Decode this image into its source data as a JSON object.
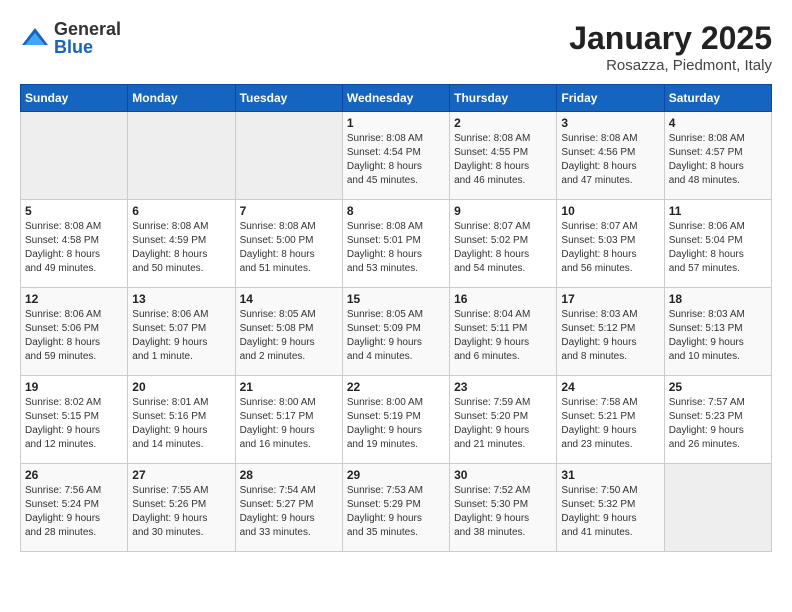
{
  "header": {
    "logo_general": "General",
    "logo_blue": "Blue",
    "month": "January 2025",
    "location": "Rosazza, Piedmont, Italy"
  },
  "days_of_week": [
    "Sunday",
    "Monday",
    "Tuesday",
    "Wednesday",
    "Thursday",
    "Friday",
    "Saturday"
  ],
  "weeks": [
    [
      {
        "day": "",
        "info": ""
      },
      {
        "day": "",
        "info": ""
      },
      {
        "day": "",
        "info": ""
      },
      {
        "day": "1",
        "info": "Sunrise: 8:08 AM\nSunset: 4:54 PM\nDaylight: 8 hours\nand 45 minutes."
      },
      {
        "day": "2",
        "info": "Sunrise: 8:08 AM\nSunset: 4:55 PM\nDaylight: 8 hours\nand 46 minutes."
      },
      {
        "day": "3",
        "info": "Sunrise: 8:08 AM\nSunset: 4:56 PM\nDaylight: 8 hours\nand 47 minutes."
      },
      {
        "day": "4",
        "info": "Sunrise: 8:08 AM\nSunset: 4:57 PM\nDaylight: 8 hours\nand 48 minutes."
      }
    ],
    [
      {
        "day": "5",
        "info": "Sunrise: 8:08 AM\nSunset: 4:58 PM\nDaylight: 8 hours\nand 49 minutes."
      },
      {
        "day": "6",
        "info": "Sunrise: 8:08 AM\nSunset: 4:59 PM\nDaylight: 8 hours\nand 50 minutes."
      },
      {
        "day": "7",
        "info": "Sunrise: 8:08 AM\nSunset: 5:00 PM\nDaylight: 8 hours\nand 51 minutes."
      },
      {
        "day": "8",
        "info": "Sunrise: 8:08 AM\nSunset: 5:01 PM\nDaylight: 8 hours\nand 53 minutes."
      },
      {
        "day": "9",
        "info": "Sunrise: 8:07 AM\nSunset: 5:02 PM\nDaylight: 8 hours\nand 54 minutes."
      },
      {
        "day": "10",
        "info": "Sunrise: 8:07 AM\nSunset: 5:03 PM\nDaylight: 8 hours\nand 56 minutes."
      },
      {
        "day": "11",
        "info": "Sunrise: 8:06 AM\nSunset: 5:04 PM\nDaylight: 8 hours\nand 57 minutes."
      }
    ],
    [
      {
        "day": "12",
        "info": "Sunrise: 8:06 AM\nSunset: 5:06 PM\nDaylight: 8 hours\nand 59 minutes."
      },
      {
        "day": "13",
        "info": "Sunrise: 8:06 AM\nSunset: 5:07 PM\nDaylight: 9 hours\nand 1 minute."
      },
      {
        "day": "14",
        "info": "Sunrise: 8:05 AM\nSunset: 5:08 PM\nDaylight: 9 hours\nand 2 minutes."
      },
      {
        "day": "15",
        "info": "Sunrise: 8:05 AM\nSunset: 5:09 PM\nDaylight: 9 hours\nand 4 minutes."
      },
      {
        "day": "16",
        "info": "Sunrise: 8:04 AM\nSunset: 5:11 PM\nDaylight: 9 hours\nand 6 minutes."
      },
      {
        "day": "17",
        "info": "Sunrise: 8:03 AM\nSunset: 5:12 PM\nDaylight: 9 hours\nand 8 minutes."
      },
      {
        "day": "18",
        "info": "Sunrise: 8:03 AM\nSunset: 5:13 PM\nDaylight: 9 hours\nand 10 minutes."
      }
    ],
    [
      {
        "day": "19",
        "info": "Sunrise: 8:02 AM\nSunset: 5:15 PM\nDaylight: 9 hours\nand 12 minutes."
      },
      {
        "day": "20",
        "info": "Sunrise: 8:01 AM\nSunset: 5:16 PM\nDaylight: 9 hours\nand 14 minutes."
      },
      {
        "day": "21",
        "info": "Sunrise: 8:00 AM\nSunset: 5:17 PM\nDaylight: 9 hours\nand 16 minutes."
      },
      {
        "day": "22",
        "info": "Sunrise: 8:00 AM\nSunset: 5:19 PM\nDaylight: 9 hours\nand 19 minutes."
      },
      {
        "day": "23",
        "info": "Sunrise: 7:59 AM\nSunset: 5:20 PM\nDaylight: 9 hours\nand 21 minutes."
      },
      {
        "day": "24",
        "info": "Sunrise: 7:58 AM\nSunset: 5:21 PM\nDaylight: 9 hours\nand 23 minutes."
      },
      {
        "day": "25",
        "info": "Sunrise: 7:57 AM\nSunset: 5:23 PM\nDaylight: 9 hours\nand 26 minutes."
      }
    ],
    [
      {
        "day": "26",
        "info": "Sunrise: 7:56 AM\nSunset: 5:24 PM\nDaylight: 9 hours\nand 28 minutes."
      },
      {
        "day": "27",
        "info": "Sunrise: 7:55 AM\nSunset: 5:26 PM\nDaylight: 9 hours\nand 30 minutes."
      },
      {
        "day": "28",
        "info": "Sunrise: 7:54 AM\nSunset: 5:27 PM\nDaylight: 9 hours\nand 33 minutes."
      },
      {
        "day": "29",
        "info": "Sunrise: 7:53 AM\nSunset: 5:29 PM\nDaylight: 9 hours\nand 35 minutes."
      },
      {
        "day": "30",
        "info": "Sunrise: 7:52 AM\nSunset: 5:30 PM\nDaylight: 9 hours\nand 38 minutes."
      },
      {
        "day": "31",
        "info": "Sunrise: 7:50 AM\nSunset: 5:32 PM\nDaylight: 9 hours\nand 41 minutes."
      },
      {
        "day": "",
        "info": ""
      }
    ]
  ]
}
